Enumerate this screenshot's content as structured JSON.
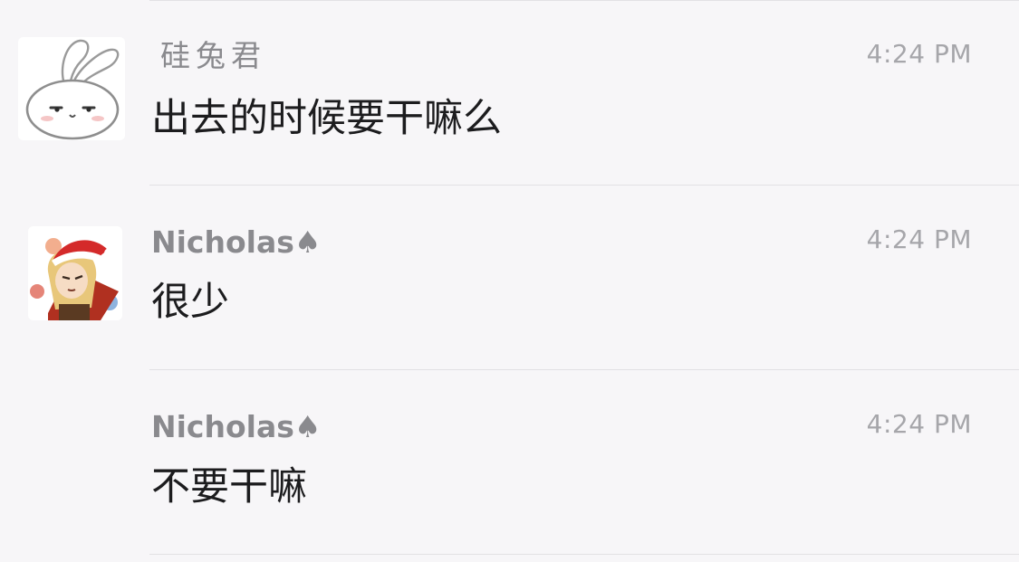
{
  "messages": [
    {
      "sender": "硅兔君",
      "time": "4:24 PM",
      "text": "出去的时候要干嘛么",
      "avatar_icon": "rabbit-avatar-icon"
    },
    {
      "sender": "Nicholas♠",
      "time": "4:24 PM",
      "text": "很少",
      "avatar_icon": "santa-hat-character-avatar-icon"
    },
    {
      "sender": "Nicholas♠",
      "time": "4:24 PM",
      "text": "不要干嘛"
    }
  ],
  "colors": {
    "background": "#f7f6f8",
    "sender_text": "#8a8a8e",
    "time_text": "#a6a6aa",
    "message_text": "#1c1c1e",
    "divider": "#e2e1e4"
  }
}
